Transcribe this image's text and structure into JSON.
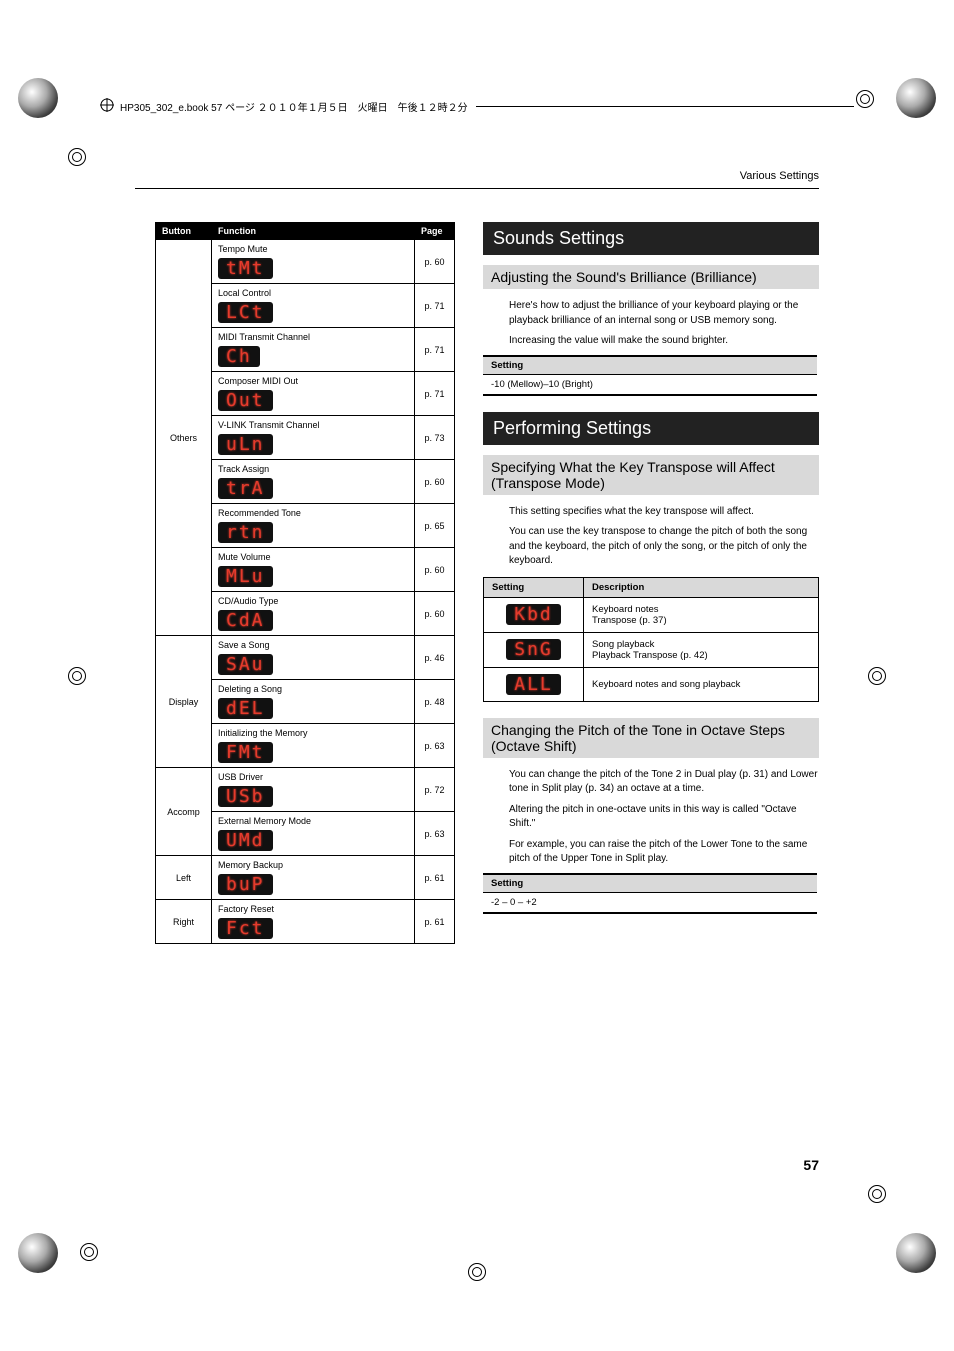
{
  "print_header": "HP305_302_e.book  57 ページ  ２０１０年１月５日　火曜日　午後１２時２分",
  "page_header": "Various Settings",
  "page_number": "57",
  "func_table": {
    "headers": {
      "button": "Button",
      "function": "Function",
      "page": "Page"
    },
    "groups": [
      {
        "button": "Others",
        "rows": [
          {
            "name": "Tempo Mute",
            "seg": "tMt",
            "page": "p. 60"
          },
          {
            "name": "Local Control",
            "seg": "LCt",
            "page": "p. 71"
          },
          {
            "name": "MIDI Transmit Channel",
            "seg": "Ch",
            "page": "p. 71"
          },
          {
            "name": "Composer MIDI Out",
            "seg": "Out",
            "page": "p. 71"
          },
          {
            "name": "V-LINK Transmit Channel",
            "seg": "uLn",
            "page": "p. 73"
          },
          {
            "name": "Track Assign",
            "seg": "trA",
            "page": "p. 60"
          },
          {
            "name": "Recommended Tone",
            "seg": "rtn",
            "page": "p. 65"
          },
          {
            "name": "Mute Volume",
            "seg": "MLu",
            "page": "p. 60"
          },
          {
            "name": "CD/Audio Type",
            "seg": "CdA",
            "page": "p. 60"
          }
        ]
      },
      {
        "button": "Display",
        "rows": [
          {
            "name": "Save a Song",
            "seg": "SAu",
            "page": "p. 46"
          },
          {
            "name": "Deleting a Song",
            "seg": "dEL",
            "page": "p. 48"
          },
          {
            "name": "Initializing the Memory",
            "seg": "FMt",
            "page": "p. 63"
          }
        ]
      },
      {
        "button": "Accomp",
        "rows": [
          {
            "name": "USB Driver",
            "seg": "USb",
            "page": "p. 72"
          },
          {
            "name": "External Memory Mode",
            "seg": "UMd",
            "page": "p. 63"
          }
        ]
      },
      {
        "button": "Left",
        "rows": [
          {
            "name": "Memory Backup",
            "seg": "buP",
            "page": "p. 61"
          }
        ]
      },
      {
        "button": "Right",
        "rows": [
          {
            "name": "Factory Reset",
            "seg": "Fct",
            "page": "p. 61"
          }
        ]
      }
    ]
  },
  "right": {
    "sounds": {
      "title": "Sounds Settings",
      "brilliance": {
        "heading": "Adjusting the Sound's Brilliance (Brilliance)",
        "para1": "Here's how to adjust the brilliance of your keyboard playing or the playback brilliance of an internal song or USB memory song.",
        "para2": "Increasing the value will make the sound brighter.",
        "setting_header": "Setting",
        "setting_value": "-10 (Mellow)–10 (Bright)"
      }
    },
    "performing": {
      "title": "Performing Settings",
      "transpose_mode": {
        "heading": "Specifying What the Key Transpose will Affect (Transpose Mode)",
        "para1": "This setting specifies what the key transpose will affect.",
        "para2": "You can use the key transpose to change the pitch of both the song and the keyboard, the pitch of only the song, or the pitch of only the keyboard.",
        "headers": {
          "setting": "Setting",
          "desc": "Description"
        },
        "rows": [
          {
            "seg": "Kbd",
            "desc_l1": "Keyboard notes",
            "desc_l2": "Transpose (p. 37)"
          },
          {
            "seg": "SnG",
            "desc_l1": "Song playback",
            "desc_l2": "Playback Transpose (p. 42)"
          },
          {
            "seg": "ALL",
            "desc_l1": "Keyboard notes and song playback",
            "desc_l2": ""
          }
        ]
      },
      "octave_shift": {
        "heading": "Changing the Pitch of the Tone in Octave Steps (Octave Shift)",
        "para1": "You can change the pitch of the Tone 2 in Dual play (p. 31) and Lower tone in Split play (p. 34) an octave at a time.",
        "para2": "Altering the pitch in one-octave units in this way is called \"Octave Shift.\"",
        "para3": "For example, you can raise the pitch of the Lower Tone to the same pitch of the Upper Tone in Split play.",
        "setting_header": "Setting",
        "setting_value": "-2 – 0 – +2"
      }
    }
  }
}
